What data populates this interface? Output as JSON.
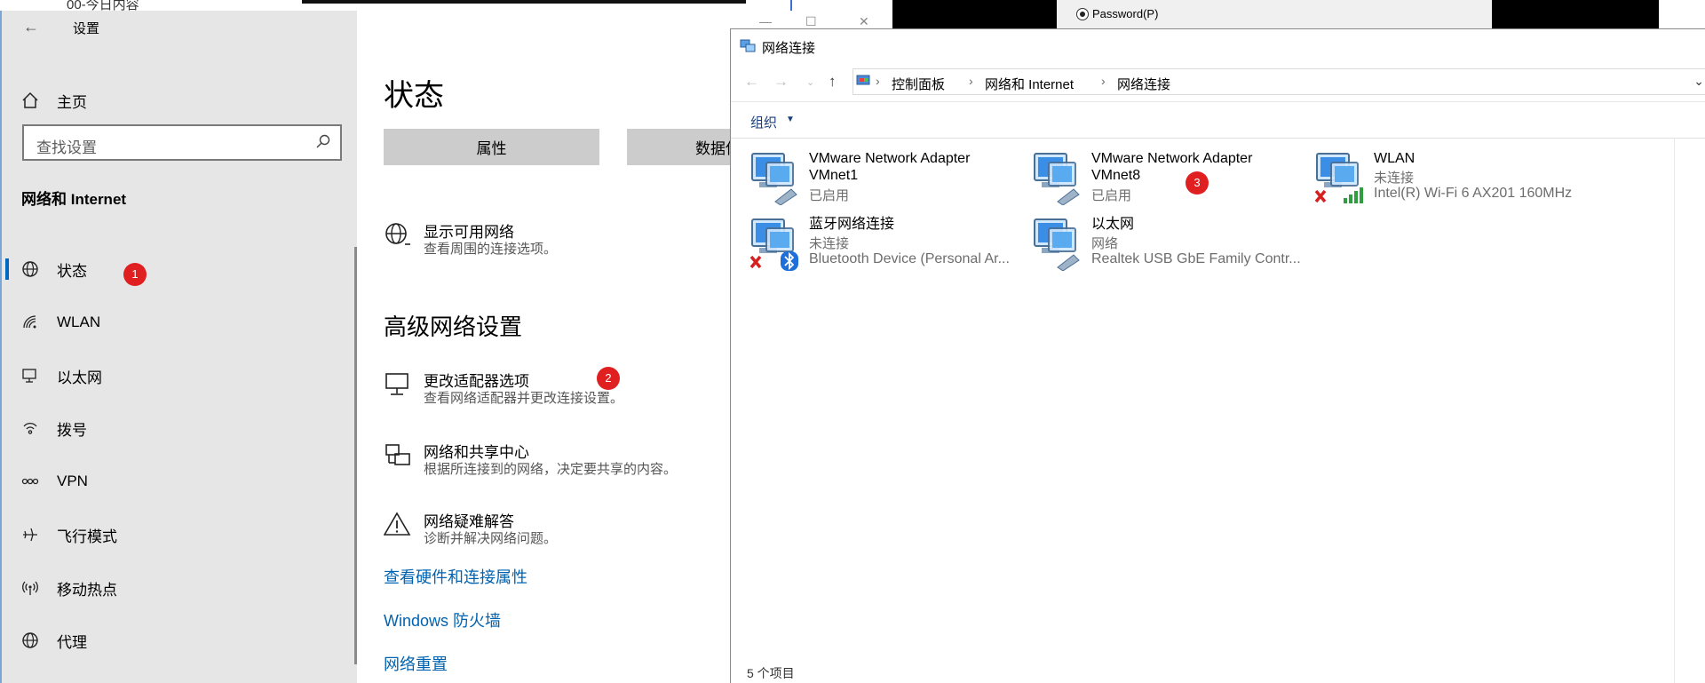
{
  "background": {
    "top_left_text": "00-今日内容",
    "dialog_radio_label": "Password(P)"
  },
  "settings": {
    "window_title": "设置",
    "back_symbol": "←",
    "window_controls": [
      "—",
      "☐",
      "✕"
    ],
    "sidebar": {
      "home_label": "主页",
      "search_placeholder": "查找设置",
      "section_title": "网络和 Internet",
      "items": [
        {
          "label": "状态",
          "icon": "globe-icon"
        },
        {
          "label": "WLAN",
          "icon": "wifi-icon"
        },
        {
          "label": "以太网",
          "icon": "ethernet-icon"
        },
        {
          "label": "拨号",
          "icon": "dialup-icon"
        },
        {
          "label": "VPN",
          "icon": "vpn-icon"
        },
        {
          "label": "飞行模式",
          "icon": "airplane-icon"
        },
        {
          "label": "移动热点",
          "icon": "hotspot-icon"
        },
        {
          "label": "代理",
          "icon": "proxy-icon"
        }
      ]
    },
    "content": {
      "title": "状态",
      "buttons": [
        "属性",
        "数据使"
      ],
      "show_networks": {
        "title": "显示可用网络",
        "desc": "查看周围的连接选项。"
      },
      "advanced_title": "高级网络设置",
      "adapter_options": {
        "title": "更改适配器选项",
        "desc": "查看网络适配器并更改连接设置。"
      },
      "sharing_center": {
        "title": "网络和共享中心",
        "desc": "根据所连接到的网络，决定要共享的内容。"
      },
      "troubleshoot": {
        "title": "网络疑难解答",
        "desc": "诊断并解决网络问题。"
      },
      "links": [
        "查看硬件和连接属性",
        "Windows 防火墙",
        "网络重置"
      ]
    }
  },
  "badges": [
    "1",
    "2",
    "3"
  ],
  "explorer": {
    "title": "网络连接",
    "breadcrumb": [
      "控制面板",
      "网络和 Internet",
      "网络连接"
    ],
    "organize_label": "组织",
    "adapters": [
      {
        "name_line1": "VMware Network Adapter",
        "name_line2": "VMnet1",
        "status": "已启用",
        "device": ""
      },
      {
        "name_line1": "VMware Network Adapter",
        "name_line2": "VMnet8",
        "status": "已启用",
        "device": ""
      },
      {
        "name_line1": "WLAN",
        "name_line2": "",
        "status": "未连接",
        "device": "Intel(R) Wi-Fi 6 AX201 160MHz"
      },
      {
        "name_line1": "蓝牙网络连接",
        "name_line2": "",
        "status": "未连接",
        "device": "Bluetooth Device (Personal Ar..."
      },
      {
        "name_line1": "以太网",
        "name_line2": "",
        "status": "网络",
        "device": "Realtek USB GbE Family Contr..."
      }
    ],
    "status_bar": "5 个项目"
  },
  "colors": {
    "accent": "#0067c0",
    "link": "#0063b1",
    "badge": "#e02020",
    "sidebar_bg": "#e6e6e6"
  }
}
